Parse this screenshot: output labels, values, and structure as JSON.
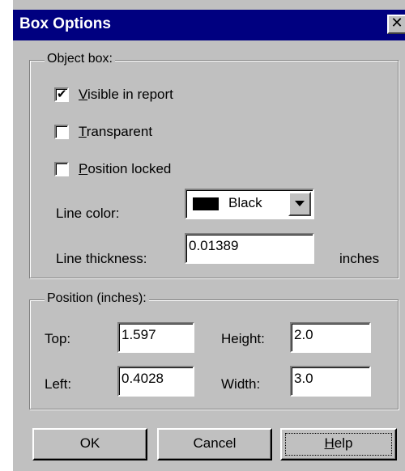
{
  "window": {
    "title": "Box Options",
    "close_glyph": "✕"
  },
  "object_box": {
    "legend": "Object box:",
    "visible": {
      "underlined_char": "V",
      "rest": "isible in report",
      "checked": true
    },
    "transparent": {
      "underlined_char": "T",
      "rest": "ransparent",
      "checked": false
    },
    "position_locked": {
      "underlined_char": "P",
      "rest": "osition locked",
      "checked": false
    },
    "line_color_label": "Line color:",
    "line_color_value": "Black",
    "line_color_swatch": "#000000",
    "line_thickness_label": "Line thickness:",
    "line_thickness_value": "0.01389",
    "line_thickness_unit": "inches"
  },
  "position": {
    "legend": "Position (inches):",
    "top_label": "Top:",
    "top_value": "1.597",
    "left_label": "Left:",
    "left_value": "0.4028",
    "height_label": "Height:",
    "height_value": "2.0",
    "width_label": "Width:",
    "width_value": "3.0"
  },
  "buttons": {
    "ok": "OK",
    "cancel": "Cancel",
    "help_underlined_char": "H",
    "help_rest": "elp"
  },
  "icons": {
    "checkmark": "✔",
    "close": "close-icon",
    "dropdown": "chevron-down-icon"
  }
}
